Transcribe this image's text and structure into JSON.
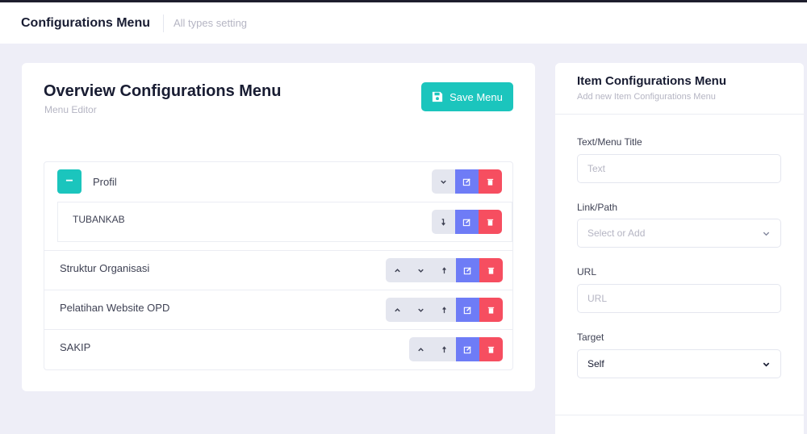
{
  "topbar": {
    "title": "Configurations Menu",
    "subtitle": "All types setting"
  },
  "overview": {
    "title": "Overview Configurations Menu",
    "subtitle": "Menu Editor",
    "save_label": "Save Menu",
    "collapse_symbol": "−",
    "items": [
      {
        "label": "Profil",
        "child": {
          "label": "TUBANKAB"
        }
      },
      {
        "label": "Struktur Organisasi"
      },
      {
        "label": "Pelatihan Website OPD"
      },
      {
        "label": "SAKIP"
      }
    ]
  },
  "form": {
    "title": "Item Configurations Menu",
    "subtitle": "Add new Item Configurations Menu",
    "fields": {
      "text_label": "Text/Menu Title",
      "text_placeholder": "Text",
      "link_label": "Link/Path",
      "link_placeholder": "Select or Add",
      "url_label": "URL",
      "url_placeholder": "URL",
      "target_label": "Target",
      "target_value": "Self"
    }
  },
  "colors": {
    "teal": "#1bc5bd",
    "edit": "#6e7cf6",
    "delete": "#f64e60",
    "neutral": "#e4e6ef"
  }
}
